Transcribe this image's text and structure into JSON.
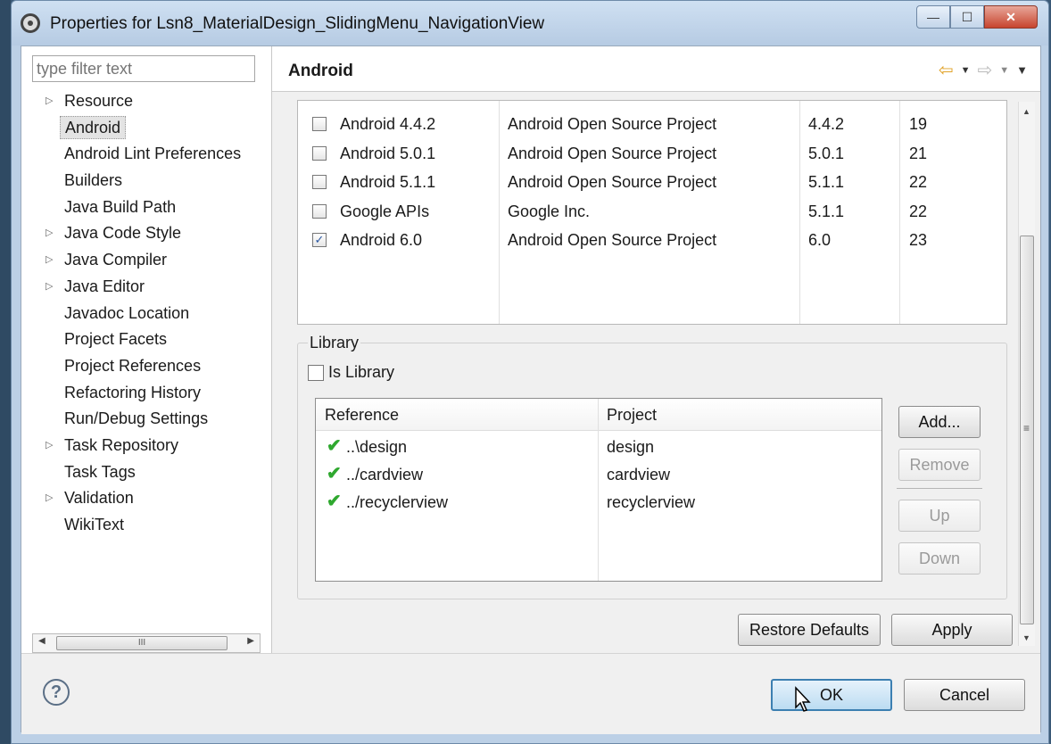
{
  "window": {
    "title": "Properties for Lsn8_MaterialDesign_SlidingMenu_NavigationView",
    "minimize_label": "—",
    "maximize_label": "☐",
    "close_label": "✕"
  },
  "nav": {
    "filter_placeholder": "type filter text",
    "items": [
      {
        "label": "Resource",
        "expandable": true
      },
      {
        "label": "Android",
        "expandable": false,
        "selected": true
      },
      {
        "label": "Android Lint Preferences",
        "expandable": false
      },
      {
        "label": "Builders",
        "expandable": false
      },
      {
        "label": "Java Build Path",
        "expandable": false
      },
      {
        "label": "Java Code Style",
        "expandable": true
      },
      {
        "label": "Java Compiler",
        "expandable": true
      },
      {
        "label": "Java Editor",
        "expandable": true
      },
      {
        "label": "Javadoc Location",
        "expandable": false
      },
      {
        "label": "Project Facets",
        "expandable": false
      },
      {
        "label": "Project References",
        "expandable": false
      },
      {
        "label": "Refactoring History",
        "expandable": false
      },
      {
        "label": "Run/Debug Settings",
        "expandable": false
      },
      {
        "label": "Task Repository",
        "expandable": true
      },
      {
        "label": "Task Tags",
        "expandable": false
      },
      {
        "label": "Validation",
        "expandable": true
      },
      {
        "label": "WikiText",
        "expandable": false
      }
    ],
    "scroll_grip": "III"
  },
  "pane": {
    "title": "Android"
  },
  "sdk_targets": [
    {
      "name": "Android 4.4.2",
      "vendor": "Android Open Source Project",
      "platform": "4.4.2",
      "api": "19",
      "checked": false
    },
    {
      "name": "Android 5.0.1",
      "vendor": "Android Open Source Project",
      "platform": "5.0.1",
      "api": "21",
      "checked": false
    },
    {
      "name": "Android 5.1.1",
      "vendor": "Android Open Source Project",
      "platform": "5.1.1",
      "api": "22",
      "checked": false
    },
    {
      "name": "Google APIs",
      "vendor": "Google Inc.",
      "platform": "5.1.1",
      "api": "22",
      "checked": false
    },
    {
      "name": "Android 6.0",
      "vendor": "Android Open Source Project",
      "platform": "6.0",
      "api": "23",
      "checked": true
    }
  ],
  "library": {
    "group_label": "Library",
    "is_library_label": "Is Library",
    "is_library_checked": false,
    "columns": {
      "reference": "Reference",
      "project": "Project"
    },
    "references": [
      {
        "reference": "..\\design",
        "project": "design"
      },
      {
        "reference": "../cardview",
        "project": "cardview"
      },
      {
        "reference": "../recyclerview",
        "project": "recyclerview"
      }
    ],
    "buttons": {
      "add": "Add...",
      "remove": "Remove",
      "up": "Up",
      "down": "Down"
    }
  },
  "actions": {
    "restore_defaults": "Restore Defaults",
    "apply": "Apply",
    "ok": "OK",
    "cancel": "Cancel",
    "help": "?"
  },
  "colors": {
    "check_green": "#2fa82f",
    "back_arrow": "#e1a227",
    "ok_focus": "#3c7fb1"
  }
}
